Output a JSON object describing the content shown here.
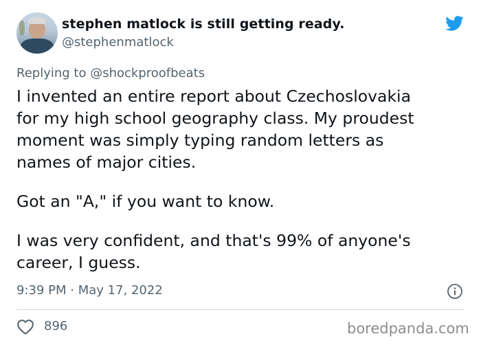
{
  "tweet": {
    "display_name": "stephen matlock is still getting ready.",
    "handle": "@stephenmatlock",
    "replying_prefix": "Replying to",
    "replying_to": "@shockproofbeats",
    "paragraphs": [
      [
        "I invented an entire report about Czechoslovakia",
        "for my high school geography class. My proudest",
        "moment was simply typing random letters as",
        "names of major cities."
      ],
      [
        "Got an \"A,\" if you want to know."
      ],
      [
        "I was very confident, and that's 99% of anyone's",
        "career, I guess."
      ]
    ],
    "timestamp": "9:39 PM · May 17, 2022",
    "like_count": "896"
  },
  "icons": {
    "brand": "twitter-bird-icon",
    "info": "info-icon",
    "like": "heart-icon"
  },
  "colors": {
    "twitter_blue": "#1d9bf0",
    "text_primary": "#0f1419",
    "text_secondary": "#536471",
    "divider": "#cfd9de"
  },
  "watermark": "boredpanda.com"
}
